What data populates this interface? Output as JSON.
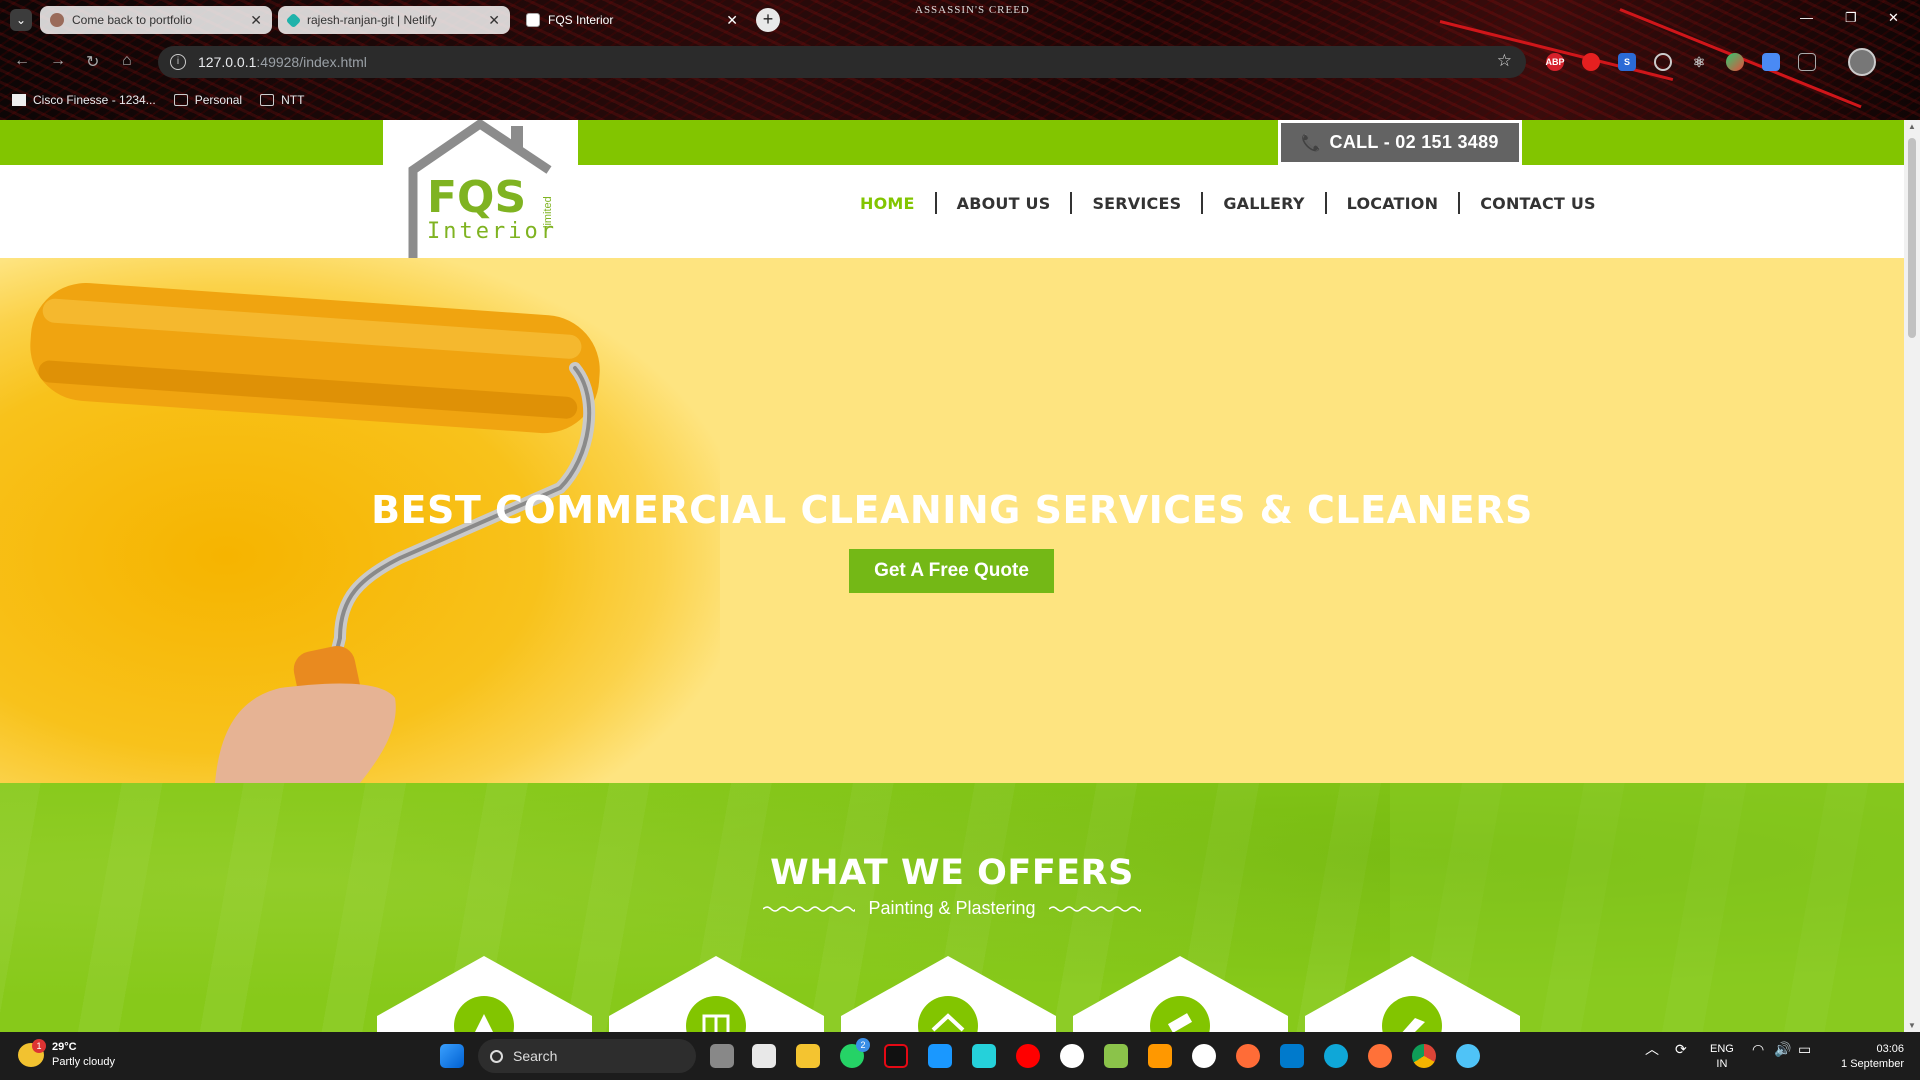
{
  "browser": {
    "tabs": [
      {
        "title": "Come back to portfolio",
        "active": false
      },
      {
        "title": "rajesh-ranjan-git | Netlify",
        "active": false
      },
      {
        "title": "FQS Interior",
        "active": true
      }
    ],
    "address": {
      "host": "127.0.0.1",
      "path": ":49928/index.html"
    },
    "bookmarks": [
      "Cisco Finesse - 1234...",
      "Personal",
      "NTT"
    ],
    "theme_logo": "ASSASSIN'S CREED"
  },
  "site": {
    "logo": {
      "main": "FQS",
      "sub": "Interior",
      "tag": "limited"
    },
    "call": "CALL - 02 151 3489",
    "nav": [
      "HOME",
      "ABOUT US",
      "SERVICES",
      "GALLERY",
      "LOCATION",
      "CONTACT US"
    ],
    "hero": {
      "title": "BEST COMMERCIAL CLEANING SERVICES & CLEANERS",
      "button": "Get A Free Quote"
    },
    "offers": {
      "title": "WHAT WE OFFERS",
      "subtitle": "Painting & Plastering"
    },
    "colors": {
      "brand_green": "#82c500",
      "hero_bg": "#fee480",
      "call_bg": "#636363"
    }
  },
  "taskbar": {
    "weather": {
      "temp": "29°C",
      "desc": "Partly cloudy",
      "badge": "1"
    },
    "search": "Search",
    "whatsapp_badge": "2",
    "lang": {
      "top": "ENG",
      "bottom": "IN"
    },
    "clock": {
      "time": "03:06",
      "date": "1 September"
    }
  }
}
